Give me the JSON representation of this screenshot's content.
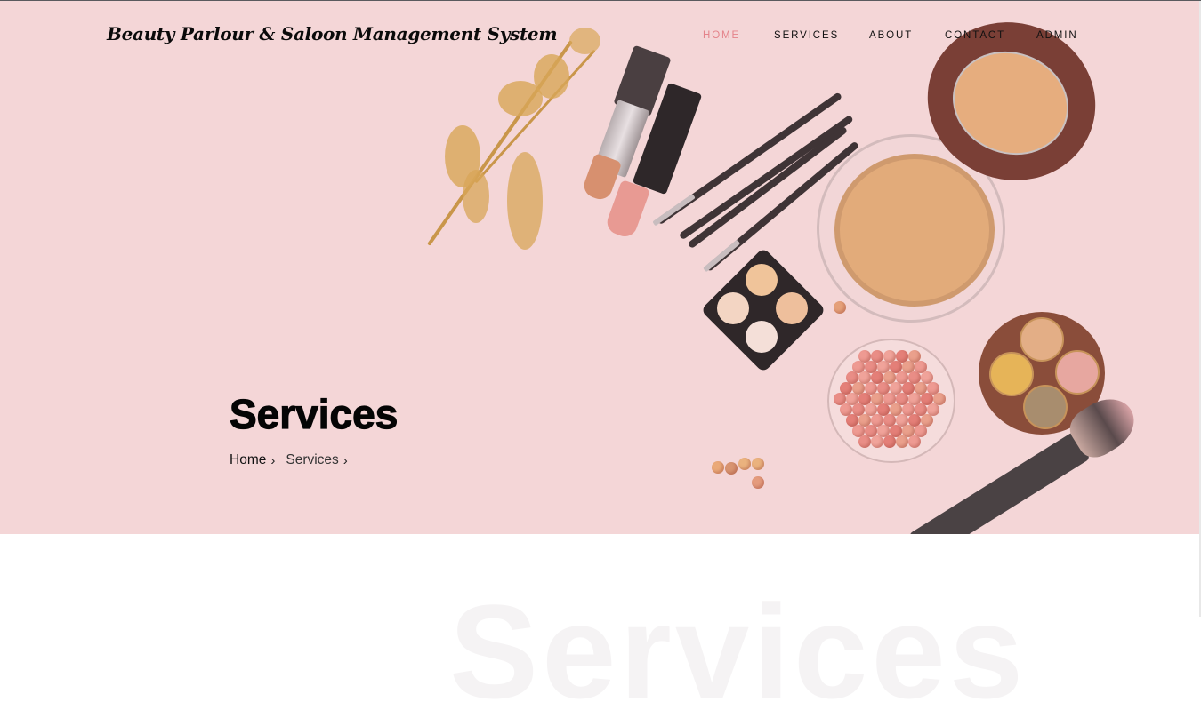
{
  "brand": {
    "title": "Beauty Parlour & Saloon Management System"
  },
  "nav": {
    "items": [
      {
        "label": "HOME",
        "active": true
      },
      {
        "label": "SERVICES",
        "active": false
      },
      {
        "label": "ABOUT",
        "active": false
      },
      {
        "label": "CONTACT",
        "active": false
      },
      {
        "label": "ADMIN",
        "active": false
      }
    ]
  },
  "hero": {
    "title": "Services",
    "breadcrumb": [
      {
        "label": "Home",
        "icon": "chevron-right-icon"
      },
      {
        "label": "Services",
        "icon": "chevron-right-icon"
      }
    ],
    "background_color": "#f4d6d7",
    "image_description": "flat-lay of cosmetics: dried flowers, lipsticks, makeup brushes, compact powder, eyeshadow palettes, blush pearls"
  },
  "colors": {
    "accent": "#e4838a",
    "text_dark": "#111111"
  },
  "section": {
    "watermark": "Services"
  },
  "icons": {
    "chevron": "›"
  }
}
